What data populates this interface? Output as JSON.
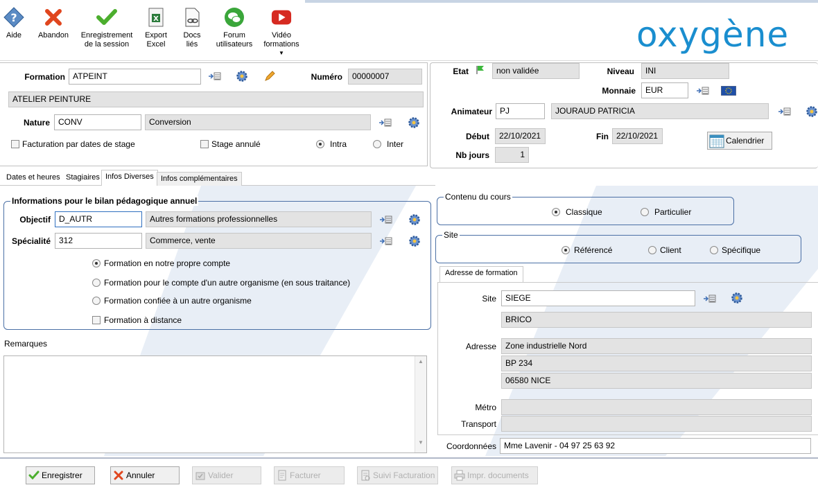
{
  "toolbar": {
    "aide": "Aide",
    "abandon": "Abandon",
    "enregistrement_l1": "Enregistrement",
    "enregistrement_l2": "de la session",
    "export_l1": "Export",
    "export_l2": "Excel",
    "docs_l1": "Docs",
    "docs_l2": "liés",
    "forum_l1": "Forum",
    "forum_l2": "utilisateurs",
    "video_l1": "Vidéo",
    "video_l2": "formations"
  },
  "brand": {
    "logo_text": "oxygène",
    "color": "#1a8ecf"
  },
  "formation": {
    "label": "Formation",
    "code": "ATPEINT",
    "numero_label": "Numéro",
    "numero": "00000007",
    "title": "ATELIER PEINTURE",
    "nature_label": "Nature",
    "nature_code": "CONV",
    "nature_value": "Conversion",
    "facturation_label": "Facturation par dates de stage",
    "stage_annule_label": "Stage annulé",
    "intra_label": "Intra",
    "inter_label": "Inter"
  },
  "right_header": {
    "etat_label": "Etat",
    "etat_value": "non validée",
    "niveau_label": "Niveau",
    "niveau_value": "INI",
    "monnaie_label": "Monnaie",
    "monnaie_value": "EUR",
    "animateur_label": "Animateur",
    "animateur_code": "PJ",
    "animateur_name": "JOURAUD PATRICIA",
    "debut_label": "Début",
    "debut_value": "22/10/2021",
    "fin_label": "Fin",
    "fin_value": "22/10/2021",
    "calendrier_label": "Calendrier",
    "nbjours_label": "Nb jours",
    "nbjours_value": "1"
  },
  "tabs": {
    "t1": "Dates et heures",
    "t2": "Stagiaires",
    "t3": "Infos Diverses",
    "t4": "Infos complémentaires"
  },
  "bilan": {
    "title": "Informations pour le bilan pédagogique annuel",
    "objectif_label": "Objectif",
    "objectif_code": "D_AUTR",
    "objectif_value": "Autres formations professionnelles",
    "specialite_label": "Spécialité",
    "specialite_code": "312",
    "specialite_value": "Commerce, vente",
    "opt1": "Formation en notre propre compte",
    "opt2": "Formation pour le compte d'un autre organisme (en sous traitance)",
    "opt3": "Formation confiée à un autre organisme",
    "opt4": "Formation à distance"
  },
  "remarques_label": "Remarques",
  "contenu": {
    "title": "Contenu du cours",
    "opt1": "Classique",
    "opt2": "Particulier"
  },
  "site_group": {
    "title": "Site",
    "opt1": "Référencé",
    "opt2": "Client",
    "opt3": "Spécifique"
  },
  "adresse": {
    "tab_label": "Adresse de formation",
    "site_label": "Site",
    "site_code": "SIEGE",
    "site_name": "BRICO",
    "adresse_label": "Adresse",
    "line1": "Zone industrielle Nord",
    "line2": "BP 234",
    "line3": "06580 NICE",
    "metro_label": "Métro",
    "transport_label": "Transport",
    "coord_label": "Coordonnées",
    "coord_value": "Mme Lavenir - 04 97 25 63 92"
  },
  "buttons": {
    "enregistrer": "Enregistrer",
    "annuler": "Annuler",
    "valider": "Valider",
    "facturer": "Facturer",
    "suivi": "Suivi Facturation",
    "imprimer": "Impr. documents"
  }
}
